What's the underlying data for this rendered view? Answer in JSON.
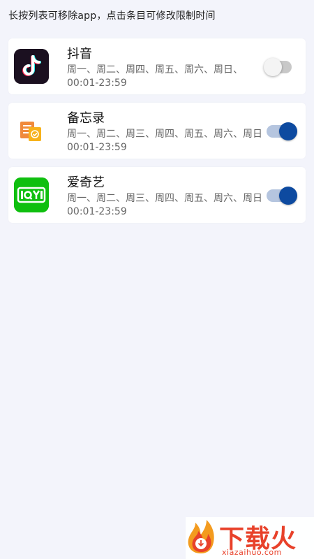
{
  "hint": "长按列表可移除app，点击条目可修改限制时间",
  "apps": [
    {
      "name": "抖音",
      "days": "周一、周二、周四、周五、周六、周日、",
      "time": "00:01-23:59",
      "enabled": false,
      "icon": "tiktok-icon"
    },
    {
      "name": "备忘录",
      "days": "周一、周二、周三、周四、周五、周六、周日",
      "time": "00:01-23:59",
      "enabled": true,
      "icon": "memo-icon"
    },
    {
      "name": "爱奇艺",
      "days": "周一、周二、周三、周四、周五、周六、周日",
      "time": "00:01-23:59",
      "enabled": true,
      "icon": "iqiyi-icon"
    }
  ],
  "watermark": {
    "text": "下载火",
    "url": "xiazaihuo.com"
  },
  "colors": {
    "background": "#f3f4fb",
    "toggle_on": "#0d4aa0",
    "toggle_off": "#c8c8c8",
    "watermark": "#e8412a"
  }
}
